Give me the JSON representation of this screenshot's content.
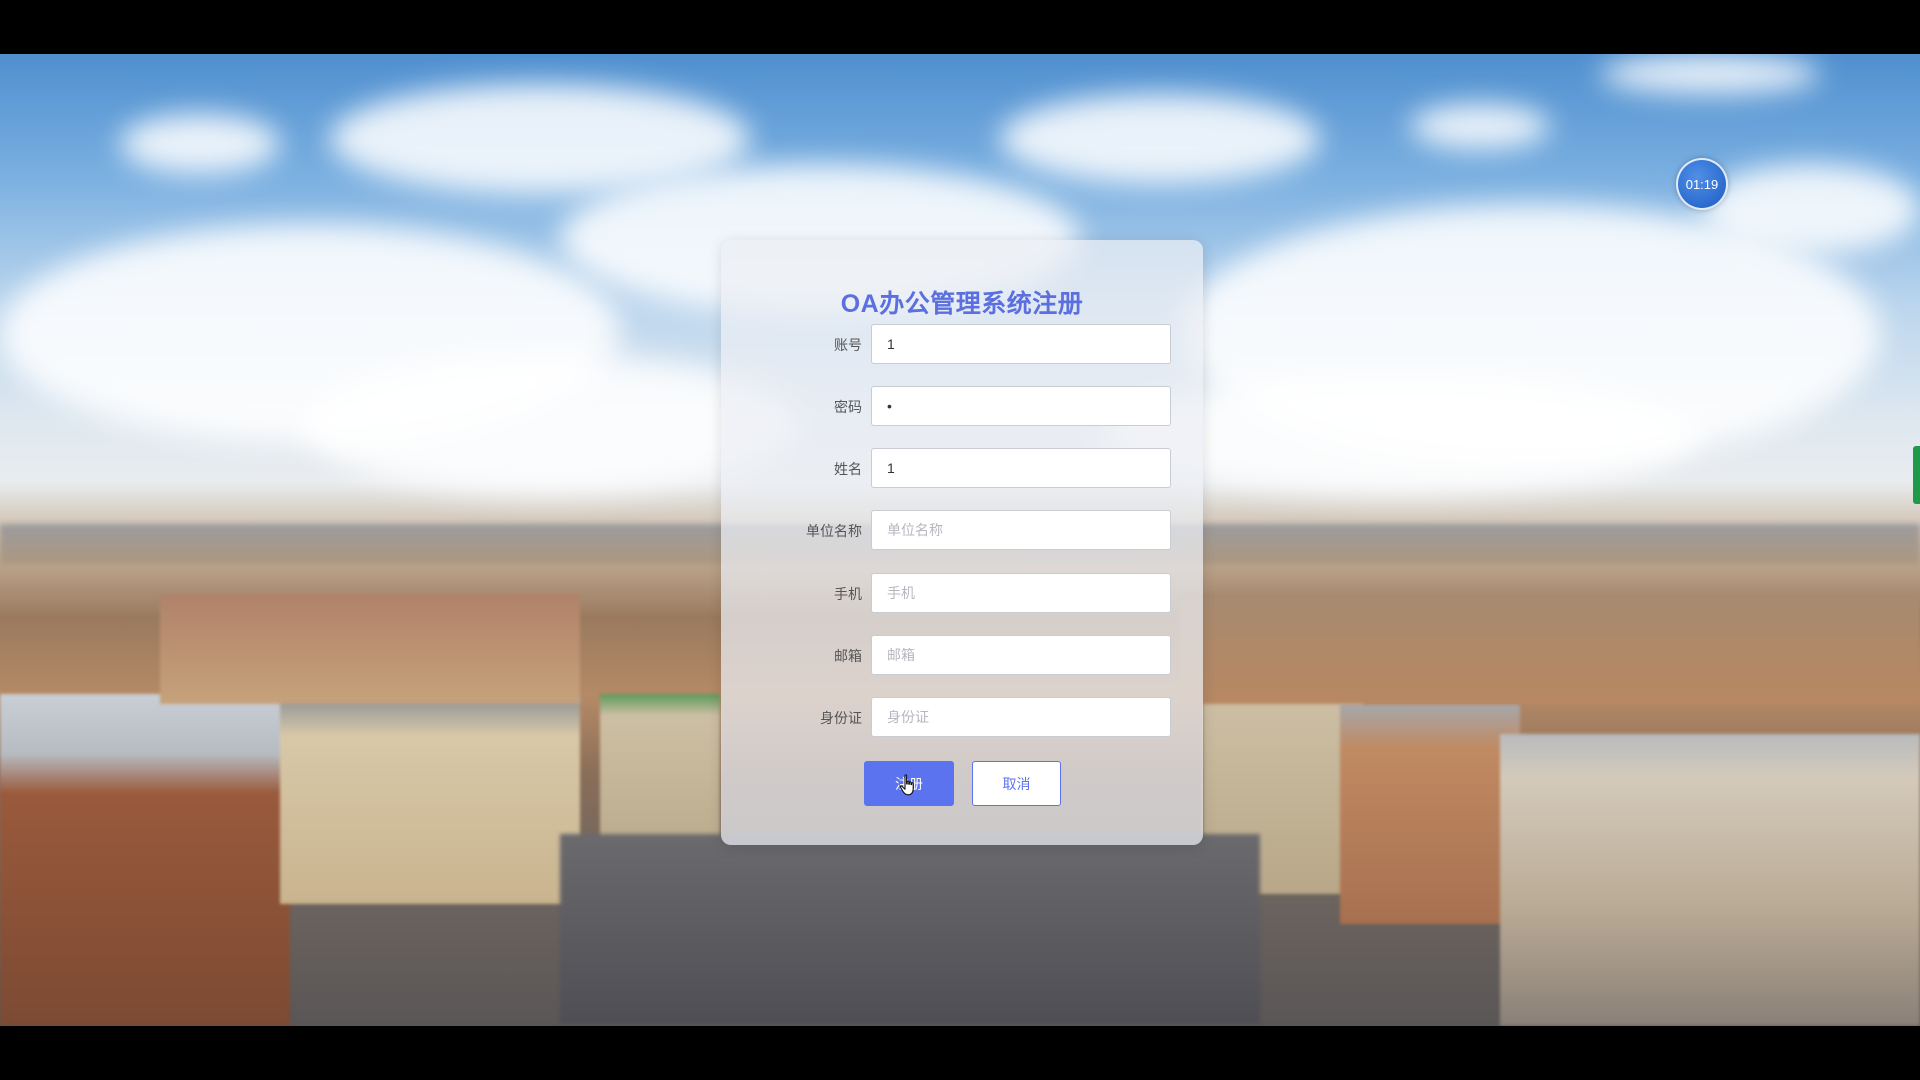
{
  "video": {
    "timer": "01:19"
  },
  "form": {
    "title": "OA办公管理系统注册",
    "fields": [
      {
        "label": "账号",
        "value": "1",
        "placeholder": ""
      },
      {
        "label": "密码",
        "value": "•",
        "placeholder": ""
      },
      {
        "label": "姓名",
        "value": "1",
        "placeholder": ""
      },
      {
        "label": "单位名称",
        "value": "",
        "placeholder": "单位名称"
      },
      {
        "label": "手机",
        "value": "",
        "placeholder": "手机"
      },
      {
        "label": "邮箱",
        "value": "",
        "placeholder": "邮箱"
      },
      {
        "label": "身份证",
        "value": "",
        "placeholder": "身份证"
      }
    ],
    "register_label": "注册",
    "cancel_label": "取消"
  },
  "colors": {
    "accent": "#5b73ee",
    "title": "#5b6fde",
    "timer_badge": "#2a6fd6",
    "edge_tab": "#1f9a4a"
  },
  "icons": {
    "cursor": "hand-pointer-icon"
  }
}
